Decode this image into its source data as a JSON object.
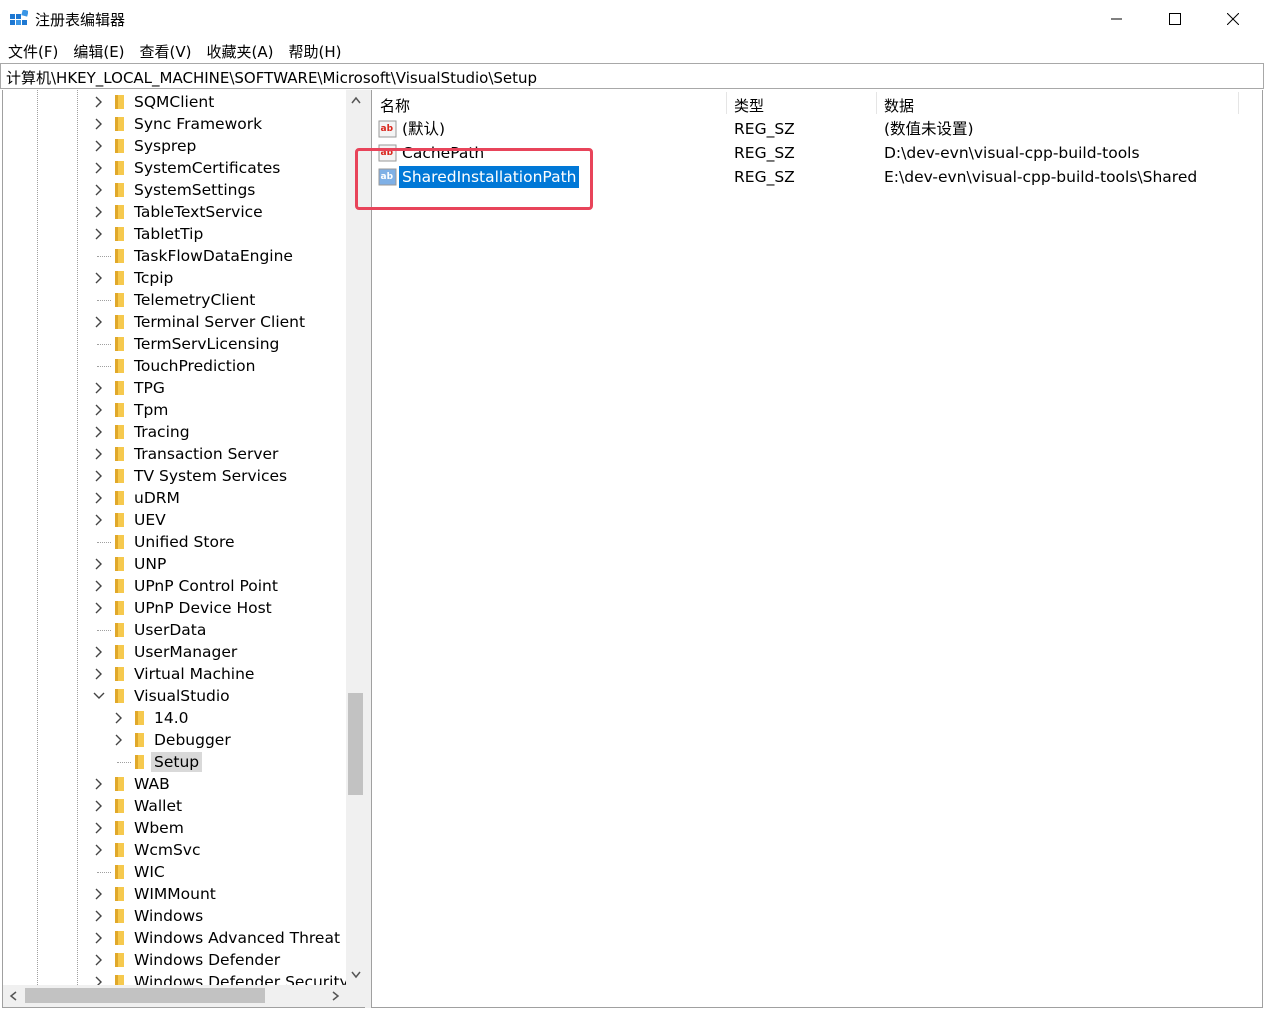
{
  "window": {
    "title": "注册表编辑器"
  },
  "menu": [
    "文件(F)",
    "编辑(E)",
    "查看(V)",
    "收藏夹(A)",
    "帮助(H)"
  ],
  "address": "计算机\\HKEY_LOCAL_MACHINE\\SOFTWARE\\Microsoft\\VisualStudio\\Setup",
  "tree": [
    {
      "label": "SQMClient",
      "level": 0,
      "expander": "collapsed"
    },
    {
      "label": "Sync Framework",
      "level": 0,
      "expander": "collapsed"
    },
    {
      "label": "Sysprep",
      "level": 0,
      "expander": "collapsed"
    },
    {
      "label": "SystemCertificates",
      "level": 0,
      "expander": "collapsed"
    },
    {
      "label": "SystemSettings",
      "level": 0,
      "expander": "collapsed"
    },
    {
      "label": "TableTextService",
      "level": 0,
      "expander": "collapsed"
    },
    {
      "label": "TabletTip",
      "level": 0,
      "expander": "collapsed"
    },
    {
      "label": "TaskFlowDataEngine",
      "level": 0,
      "expander": "none"
    },
    {
      "label": "Tcpip",
      "level": 0,
      "expander": "collapsed"
    },
    {
      "label": "TelemetryClient",
      "level": 0,
      "expander": "none"
    },
    {
      "label": "Terminal Server Client",
      "level": 0,
      "expander": "collapsed"
    },
    {
      "label": "TermServLicensing",
      "level": 0,
      "expander": "none"
    },
    {
      "label": "TouchPrediction",
      "level": 0,
      "expander": "none"
    },
    {
      "label": "TPG",
      "level": 0,
      "expander": "collapsed"
    },
    {
      "label": "Tpm",
      "level": 0,
      "expander": "collapsed"
    },
    {
      "label": "Tracing",
      "level": 0,
      "expander": "collapsed"
    },
    {
      "label": "Transaction Server",
      "level": 0,
      "expander": "collapsed"
    },
    {
      "label": "TV System Services",
      "level": 0,
      "expander": "collapsed"
    },
    {
      "label": "uDRM",
      "level": 0,
      "expander": "collapsed"
    },
    {
      "label": "UEV",
      "level": 0,
      "expander": "collapsed"
    },
    {
      "label": "Unified Store",
      "level": 0,
      "expander": "none"
    },
    {
      "label": "UNP",
      "level": 0,
      "expander": "collapsed"
    },
    {
      "label": "UPnP Control Point",
      "level": 0,
      "expander": "collapsed"
    },
    {
      "label": "UPnP Device Host",
      "level": 0,
      "expander": "collapsed"
    },
    {
      "label": "UserData",
      "level": 0,
      "expander": "none"
    },
    {
      "label": "UserManager",
      "level": 0,
      "expander": "collapsed"
    },
    {
      "label": "Virtual Machine",
      "level": 0,
      "expander": "collapsed"
    },
    {
      "label": "VisualStudio",
      "level": 0,
      "expander": "expanded"
    },
    {
      "label": "14.0",
      "level": 1,
      "expander": "collapsed"
    },
    {
      "label": "Debugger",
      "level": 1,
      "expander": "collapsed"
    },
    {
      "label": "Setup",
      "level": 1,
      "expander": "none",
      "selected": true
    },
    {
      "label": "WAB",
      "level": 0,
      "expander": "collapsed"
    },
    {
      "label": "Wallet",
      "level": 0,
      "expander": "collapsed"
    },
    {
      "label": "Wbem",
      "level": 0,
      "expander": "collapsed"
    },
    {
      "label": "WcmSvc",
      "level": 0,
      "expander": "collapsed"
    },
    {
      "label": "WIC",
      "level": 0,
      "expander": "none"
    },
    {
      "label": "WIMMount",
      "level": 0,
      "expander": "collapsed"
    },
    {
      "label": "Windows",
      "level": 0,
      "expander": "collapsed"
    },
    {
      "label": "Windows Advanced Threat Pr",
      "level": 0,
      "expander": "collapsed"
    },
    {
      "label": "Windows Defender",
      "level": 0,
      "expander": "collapsed"
    },
    {
      "label": "Windows Defender Security C",
      "level": 0,
      "expander": "collapsed"
    }
  ],
  "list": {
    "columns": [
      "名称",
      "类型",
      "数据"
    ],
    "rows": [
      {
        "name": "(默认)",
        "type": "REG_SZ",
        "data": "(数值未设置)",
        "selected": false
      },
      {
        "name": "CachePath",
        "type": "REG_SZ",
        "data": "D:\\dev-evn\\visual-cpp-build-tools",
        "selected": false
      },
      {
        "name": "SharedInstallationPath",
        "type": "REG_SZ",
        "data": "E:\\dev-evn\\visual-cpp-build-tools\\Shared",
        "selected": true
      }
    ]
  },
  "icons": {
    "app": "registry-editor-icon",
    "folder": "folder-icon",
    "value": "string-value-icon"
  },
  "colors": {
    "selection": "#0078d7",
    "highlight": "#e8445a",
    "folder": "#f6c94e"
  }
}
